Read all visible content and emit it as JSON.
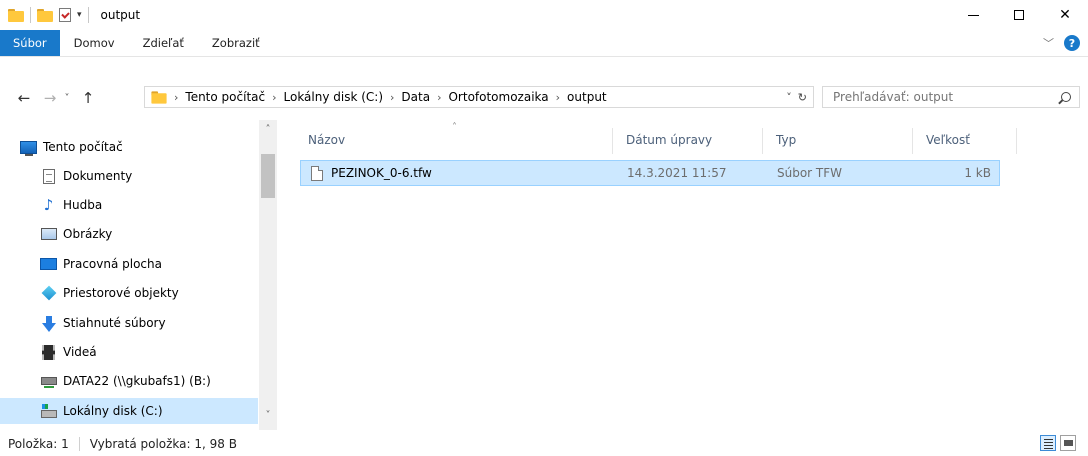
{
  "window": {
    "title": "output",
    "qa_dropdown": "▾",
    "minimize_label": "",
    "maximize_label": "",
    "close_label": "✕"
  },
  "ribbon": {
    "tabs": [
      {
        "label": "Súbor"
      },
      {
        "label": "Domov"
      },
      {
        "label": "Zdieľať"
      },
      {
        "label": "Zobraziť"
      }
    ],
    "collapse_glyph": "﹀",
    "help_label": "?"
  },
  "nav": {
    "back": "←",
    "forward": "→",
    "recent": "˅",
    "up": "↑"
  },
  "address": {
    "crumbs": [
      "Tento počítač",
      "Lokálny disk (C:)",
      "Data",
      "Ortofotomozaika",
      "output"
    ],
    "separator": "›",
    "dropdown": "˅",
    "refresh": "↻"
  },
  "search": {
    "placeholder": "Prehľadávať: output"
  },
  "navpane": {
    "items": [
      {
        "label": "Tento počítač",
        "icon": "computer-icon"
      },
      {
        "label": "Dokumenty",
        "icon": "documents-icon"
      },
      {
        "label": "Hudba",
        "icon": "music-icon"
      },
      {
        "label": "Obrázky",
        "icon": "pictures-icon"
      },
      {
        "label": "Pracovná plocha",
        "icon": "desktop-icon"
      },
      {
        "label": "Priestorové objekty",
        "icon": "3d-objects-icon"
      },
      {
        "label": "Stiahnuté súbory",
        "icon": "downloads-icon"
      },
      {
        "label": "Videá",
        "icon": "videos-icon"
      },
      {
        "label": "DATA22 (\\\\gkubafs1) (B:)",
        "icon": "network-drive-icon"
      },
      {
        "label": "Lokálny disk (C:)",
        "icon": "local-disk-icon",
        "selected": true
      }
    ],
    "scroll_up": "˄",
    "scroll_down": "˅"
  },
  "columns": {
    "name": "Názov",
    "date": "Dátum úpravy",
    "type": "Typ",
    "size": "Veľkosť",
    "sort_glyph": "˄"
  },
  "files": [
    {
      "name": "PEZINOK_0-6.tfw",
      "date": "14.3.2021 11:57",
      "type": "Súbor TFW",
      "size": "1 kB",
      "selected": true
    }
  ],
  "status": {
    "items": "Položka: 1",
    "selection": "Vybratá položka: 1, 98 B"
  },
  "colors": {
    "accent": "#1979ca",
    "selection": "#cce8ff",
    "selection_border": "#99d1ff"
  }
}
